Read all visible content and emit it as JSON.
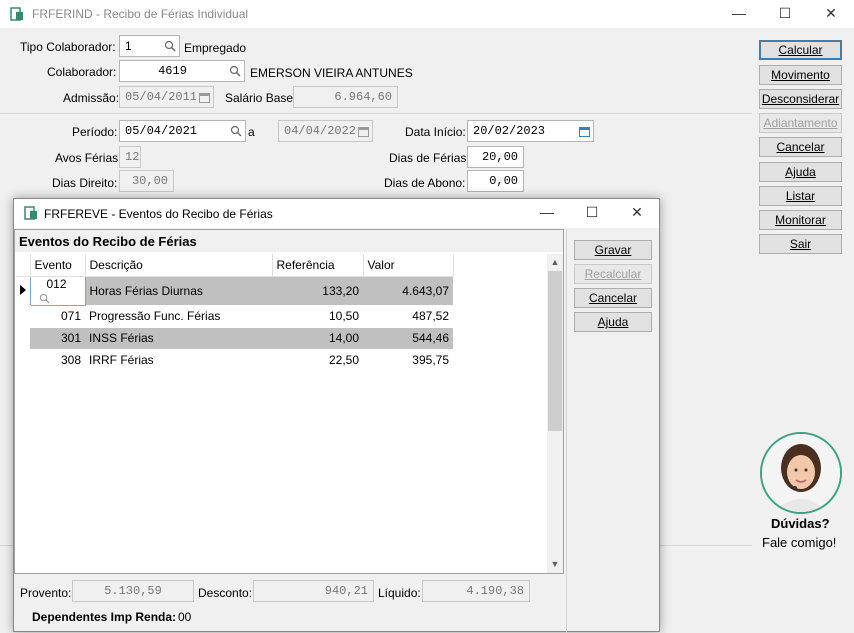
{
  "window": {
    "title": "FRFERIND - Recibo de Férias Individual"
  },
  "form": {
    "tipo_colaborador": {
      "label": "Tipo Colaborador:",
      "value": "1",
      "desc": "Empregado"
    },
    "colaborador": {
      "label": "Colaborador:",
      "value": "4619",
      "desc": "EMERSON VIEIRA ANTUNES"
    },
    "admissao": {
      "label": "Admissão:",
      "value": "05/04/2011"
    },
    "salario_base": {
      "label": "Salário Base:",
      "value": "6.964,60"
    },
    "periodo": {
      "label": "Período:",
      "start": "05/04/2021",
      "sep": "a",
      "end": "04/04/2022"
    },
    "data_inicio": {
      "label": "Data Início:",
      "value": "20/02/2023"
    },
    "avos_ferias": {
      "label": "Avos Férias:",
      "value": "12"
    },
    "dias_ferias": {
      "label": "Dias de Férias:",
      "value": "20,00"
    },
    "dias_direito": {
      "label": "Dias Direito:",
      "value": "30,00"
    },
    "dias_abono": {
      "label": "Dias de Abono:",
      "value": "0,00"
    }
  },
  "side_buttons": [
    "Calcular",
    "Movimento",
    "Desconsiderar",
    "Adiantamento",
    "Cancelar",
    "Ajuda",
    "Listar",
    "Monitorar",
    "Sair"
  ],
  "help": {
    "title": "Dúvidas?",
    "subtitle": "Fale comigo!"
  },
  "dialog": {
    "title": "FRFEREVE - Eventos do Recibo de Férias",
    "section_title": "Eventos do Recibo de Férias",
    "columns": [
      "Evento",
      "Descrição",
      "Referência",
      "Valor"
    ],
    "rows": [
      {
        "evento": "012",
        "descricao": "Horas Férias Diurnas",
        "referencia": "133,20",
        "valor": "4.643,07"
      },
      {
        "evento": "071",
        "descricao": "Progressão Func. Férias",
        "referencia": "10,50",
        "valor": "487,52"
      },
      {
        "evento": "301",
        "descricao": "INSS Férias",
        "referencia": "14,00",
        "valor": "544,46"
      },
      {
        "evento": "308",
        "descricao": "IRRF Férias",
        "referencia": "22,50",
        "valor": "395,75"
      }
    ],
    "buttons": [
      "Gravar",
      "Recalcular",
      "Cancelar",
      "Ajuda"
    ],
    "provento": {
      "label": "Provento:",
      "value": "5.130,59"
    },
    "desconto": {
      "label": "Desconto:",
      "value": "940,21"
    },
    "liquido": {
      "label": "Líquido:",
      "value": "4.190,38"
    },
    "dependentes": {
      "label": "Dependentes Imp Renda:",
      "value": "00"
    }
  },
  "colors": {
    "row_highlight": "#c0c0c0",
    "focus_border": "#3c7fb1",
    "avatar_ring": "#3aa37f"
  },
  "icons": [
    "app-icon",
    "search-icon",
    "calendar-icon",
    "minimize-icon",
    "maximize-icon",
    "close-icon",
    "row-pointer-icon",
    "scroll-up-icon",
    "scroll-down-icon"
  ]
}
